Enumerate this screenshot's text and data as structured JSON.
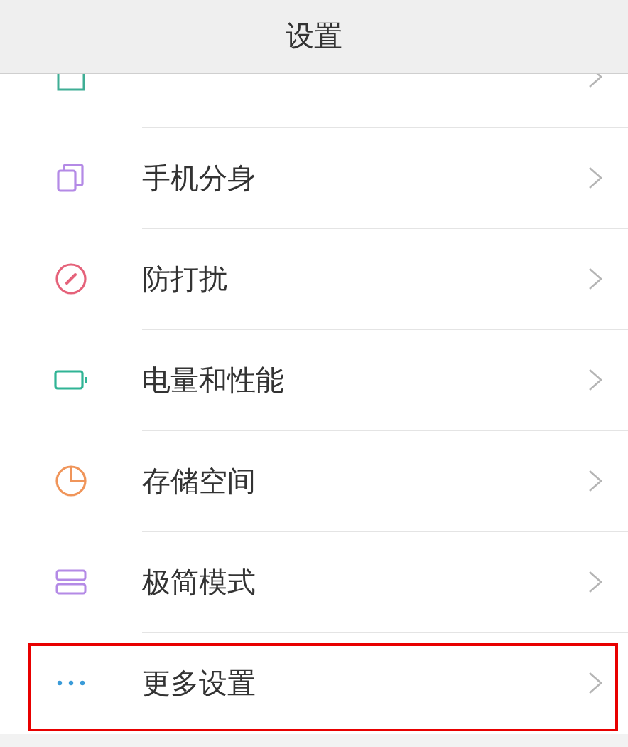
{
  "header": {
    "title": "设置"
  },
  "items": [
    {
      "kind": "desktop",
      "highlighted": false
    },
    {
      "kind": "clone",
      "label": "手机分身",
      "highlighted": false
    },
    {
      "kind": "dnd",
      "label": "防打扰",
      "highlighted": false
    },
    {
      "kind": "battery",
      "label": "电量和性能",
      "highlighted": false
    },
    {
      "kind": "storage",
      "label": "存储空间",
      "highlighted": false
    },
    {
      "kind": "minimal",
      "label": "极简模式",
      "highlighted": false
    },
    {
      "kind": "more",
      "label": "更多设置",
      "highlighted": true
    }
  ]
}
